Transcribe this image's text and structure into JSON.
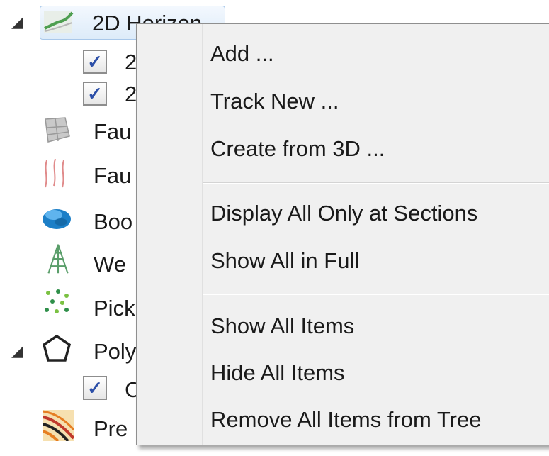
{
  "tree": {
    "items": [
      {
        "label": "2D Horizon",
        "icon": "horizon-2d-icon",
        "expanded": true
      },
      {
        "label": "2",
        "checked": true
      },
      {
        "label": "2",
        "checked": true
      },
      {
        "label": "Fau",
        "icon": "fault-surface-icon"
      },
      {
        "label": "Fau",
        "icon": "fault-sticks-icon"
      },
      {
        "label": "Boo",
        "icon": "body-icon"
      },
      {
        "label": "We",
        "icon": "well-icon"
      },
      {
        "label": "Pick",
        "icon": "picks-icon"
      },
      {
        "label": "Poly",
        "icon": "polygon-icon",
        "expanded": true
      },
      {
        "label": "C",
        "checked": true
      },
      {
        "label": "Pre",
        "icon": "pre-stack-icon"
      }
    ]
  },
  "context_menu": {
    "groups": [
      [
        "Add ...",
        "Track New ...",
        "Create from 3D ..."
      ],
      [
        "Display All Only at Sections",
        "Show All in Full"
      ],
      [
        "Show All Items",
        "Hide All Items",
        "Remove All Items from Tree"
      ]
    ]
  },
  "colors": {
    "selection_fill": "#ddebf9",
    "selection_border": "#a9c8ea",
    "menu_bg": "#f0f0f0",
    "checkmark": "#2c4fa8"
  }
}
